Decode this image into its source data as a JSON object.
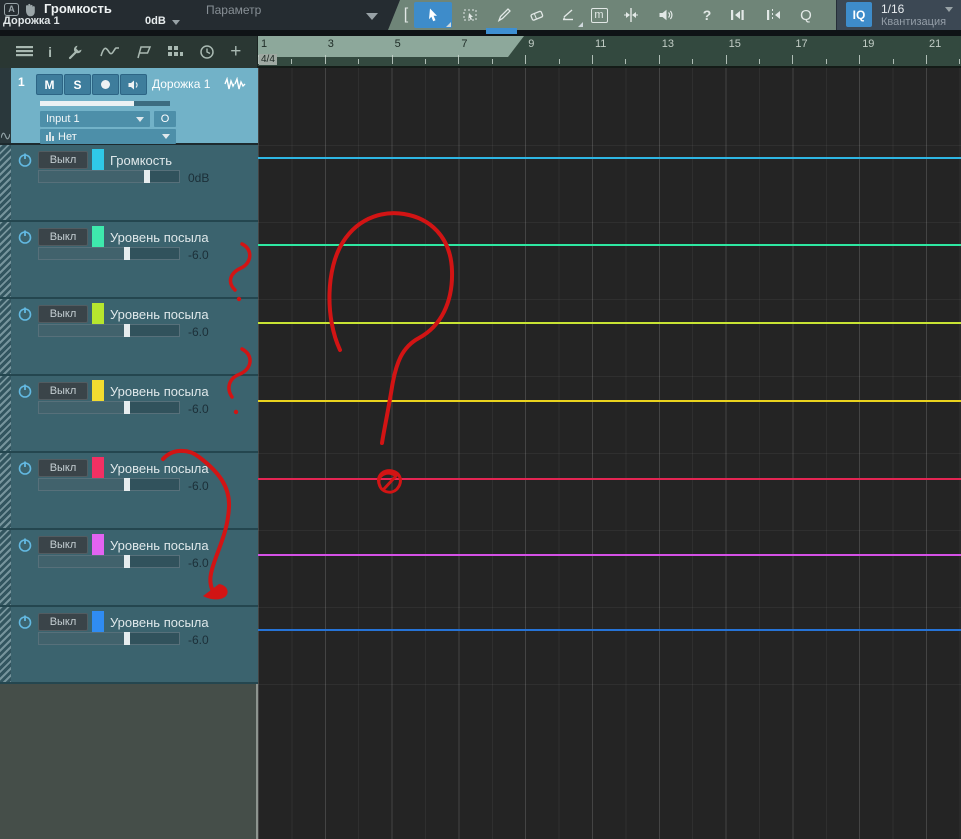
{
  "title_bar": {
    "automation_param": "Громкость",
    "track_name": "Дорожка 1",
    "param_value": "0dB",
    "parameter_label": "Параметр"
  },
  "toolbar": {
    "bracket": "[",
    "mute": "m",
    "help": "?",
    "quantize_q": "Q",
    "iq": "IQ",
    "quantize_value": "1/16",
    "quantize_label": "Квантизация"
  },
  "track_toolbar": {
    "info": "i",
    "plus": "+"
  },
  "ruler": {
    "time_signature": "4/4",
    "bar_numbers": [
      "1",
      "3",
      "5",
      "7",
      "9",
      "11",
      "13",
      "15",
      "17",
      "19",
      "21"
    ]
  },
  "track_header": {
    "number": "1",
    "mute": "M",
    "solo": "S",
    "name": "Дорожка 1",
    "input_value": "Input 1",
    "output_value": "Нет",
    "monitor_circle": "O"
  },
  "lanes": [
    {
      "off": "Выкл",
      "name": "Громкость",
      "value": "0dB",
      "color": "#2fc9e8",
      "line": "#2eb6e4",
      "slider_pct": 77
    },
    {
      "off": "Выкл",
      "name": "Уровень посыла",
      "value": "-6.0",
      "color": "#3ee9ad",
      "line": "#2ee8a2",
      "slider_pct": 63
    },
    {
      "off": "Выкл",
      "name": "Уровень посыла",
      "value": "-6.0",
      "color": "#b7e62e",
      "line": "#c8e434",
      "slider_pct": 63
    },
    {
      "off": "Выкл",
      "name": "Уровень посыла",
      "value": "-6.0",
      "color": "#f2dc30",
      "line": "#ead31e",
      "slider_pct": 63
    },
    {
      "off": "Выкл",
      "name": "Уровень посыла",
      "value": "-6.0",
      "color": "#f23063",
      "line": "#e32553",
      "slider_pct": 63
    },
    {
      "off": "Выкл",
      "name": "Уровень посыла",
      "value": "-6.0",
      "color": "#e263f2",
      "line": "#d551e6",
      "slider_pct": 63
    },
    {
      "off": "Выкл",
      "name": "Уровень посыла",
      "value": "-6.0",
      "color": "#2f8cf2",
      "line": "#2673d6",
      "slider_pct": 63
    }
  ],
  "annotation_color": "#d21414"
}
